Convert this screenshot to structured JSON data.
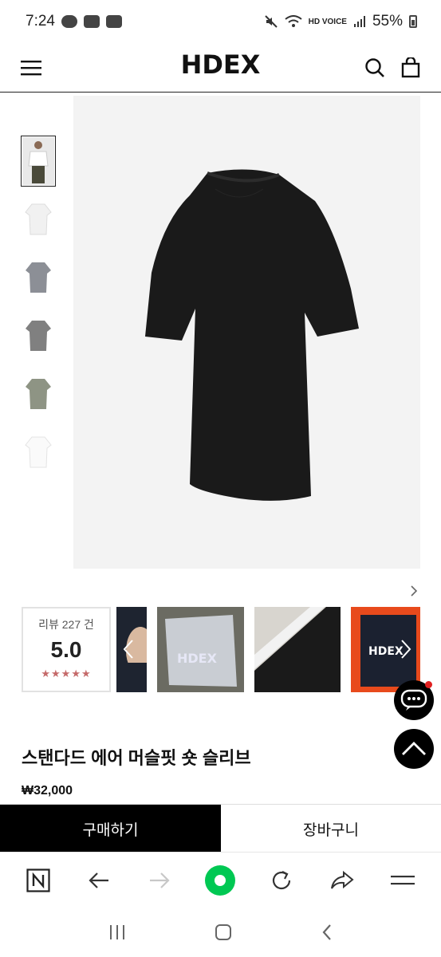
{
  "status_bar": {
    "time": "7:24",
    "app_badges": [
      "TALK",
      "WEB TOON"
    ],
    "network_label": "HD VOICE",
    "battery": "55%"
  },
  "header": {
    "brand": "HDEX"
  },
  "gallery": {
    "thumbnails": [
      "model-white-tee",
      "white-tee",
      "grey-tee",
      "dark-grey-tee",
      "olive-tee",
      "white-tee-2"
    ],
    "selected_index": 0,
    "main_image": "black-tee"
  },
  "reviews": {
    "count_label": "리뷰 227 건",
    "score": "5.0",
    "stars": "★★★★★"
  },
  "product": {
    "name": "스탠다드 에어 머슬핏 숏 슬리브",
    "price": "₩32,000"
  },
  "actions": {
    "buy_label": "구매하기",
    "cart_label": "장바구니"
  },
  "colors": {
    "accent_green": "#00c853",
    "star_color": "#c56a6a"
  }
}
